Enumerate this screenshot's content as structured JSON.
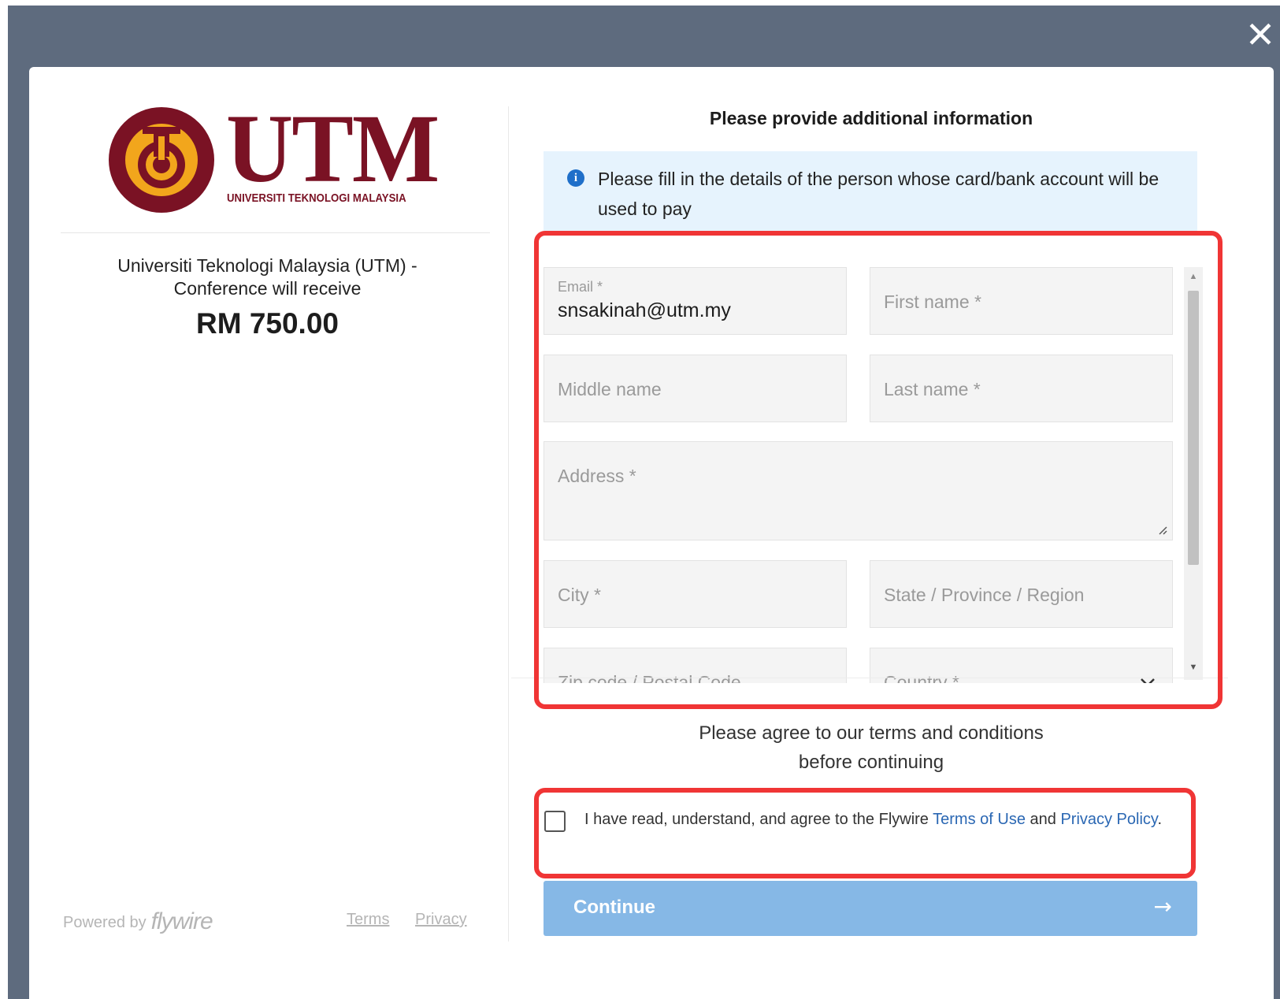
{
  "colors": {
    "backdrop": "#5e6b7e",
    "utm_maroon": "#7a1224",
    "utm_gold": "#f2a61c",
    "info_bg": "#e6f3fd",
    "info_icon": "#1f6fc9",
    "link": "#2a67b3",
    "continue_bg": "#86b8e6",
    "highlight": "#f03535"
  },
  "modal": {
    "close_icon": "close-icon",
    "close_glyph": "✕"
  },
  "left": {
    "logo_text": "UTM",
    "logo_subtitle": "UNIVERSITI TEKNOLOGI MALAYSIA",
    "merchant_line1": "Universiti Teknologi Malaysia (UTM) -",
    "merchant_line2": "Conference will receive",
    "amount": "RM 750.00",
    "powered_by": "Powered by",
    "brand": "flywire",
    "links": {
      "terms": "Terms",
      "privacy": "Privacy"
    }
  },
  "right": {
    "heading": "Please provide additional information",
    "info": {
      "icon": "info-icon",
      "icon_glyph": "i",
      "text": "Please fill in the details of the person whose card/bank account will be used to pay"
    },
    "form": {
      "email": {
        "label": "Email *",
        "value": "snsakinah@utm.my"
      },
      "first_name": {
        "placeholder": "First name *"
      },
      "middle_name": {
        "placeholder": "Middle name"
      },
      "last_name": {
        "placeholder": "Last name *"
      },
      "address": {
        "placeholder": "Address *"
      },
      "city": {
        "placeholder": "City *"
      },
      "state": {
        "placeholder": "State / Province / Region"
      },
      "zip": {
        "placeholder": "Zip code / Postal Code"
      },
      "country": {
        "placeholder": "Country *",
        "icon": "chevron-down-icon"
      }
    },
    "terms_note_line1": "Please agree to our terms and conditions",
    "terms_note_line2": "before continuing",
    "agreement": {
      "checked": false,
      "prefix": "I have read, understand, and agree to the Flywire ",
      "terms_link": "Terms of Use",
      "and": " and ",
      "privacy_link": "Privacy Policy",
      "suffix": "."
    },
    "continue_label": "Continue",
    "continue_icon": "arrow-right-icon",
    "continue_glyph": "→"
  }
}
